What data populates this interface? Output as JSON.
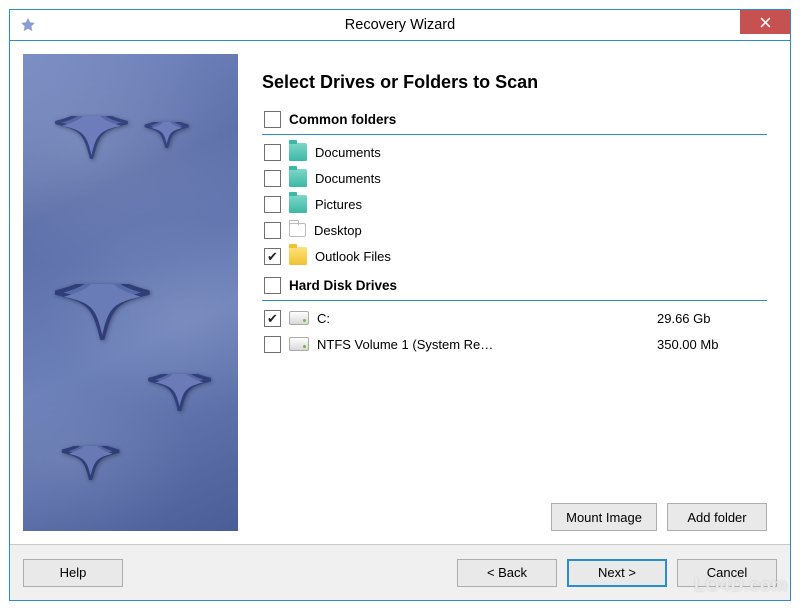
{
  "window": {
    "title": "Recovery Wizard"
  },
  "page": {
    "heading": "Select Drives or Folders to Scan",
    "sections": {
      "common": {
        "label": "Common folders",
        "checked": false,
        "items": [
          {
            "label": "Documents",
            "checked": false,
            "icon": "folder-teal"
          },
          {
            "label": "Documents",
            "checked": false,
            "icon": "folder-teal"
          },
          {
            "label": "Pictures",
            "checked": false,
            "icon": "folder-teal"
          },
          {
            "label": "Desktop",
            "checked": false,
            "icon": "folder-empty"
          },
          {
            "label": "Outlook Files",
            "checked": true,
            "icon": "folder-yellow"
          }
        ]
      },
      "drives": {
        "label": "Hard Disk Drives",
        "checked": false,
        "items": [
          {
            "label": "C:",
            "size": "29.66 Gb",
            "checked": true,
            "icon": "drive"
          },
          {
            "label": "NTFS Volume 1 (System Re…",
            "size": "350.00 Mb",
            "checked": false,
            "icon": "drive"
          }
        ]
      }
    },
    "actions": {
      "mount_image": "Mount Image",
      "add_folder": "Add folder"
    }
  },
  "footer": {
    "help": "Help",
    "back": "< Back",
    "next": "Next >",
    "cancel": "Cancel"
  },
  "watermark": "LO4D.com"
}
